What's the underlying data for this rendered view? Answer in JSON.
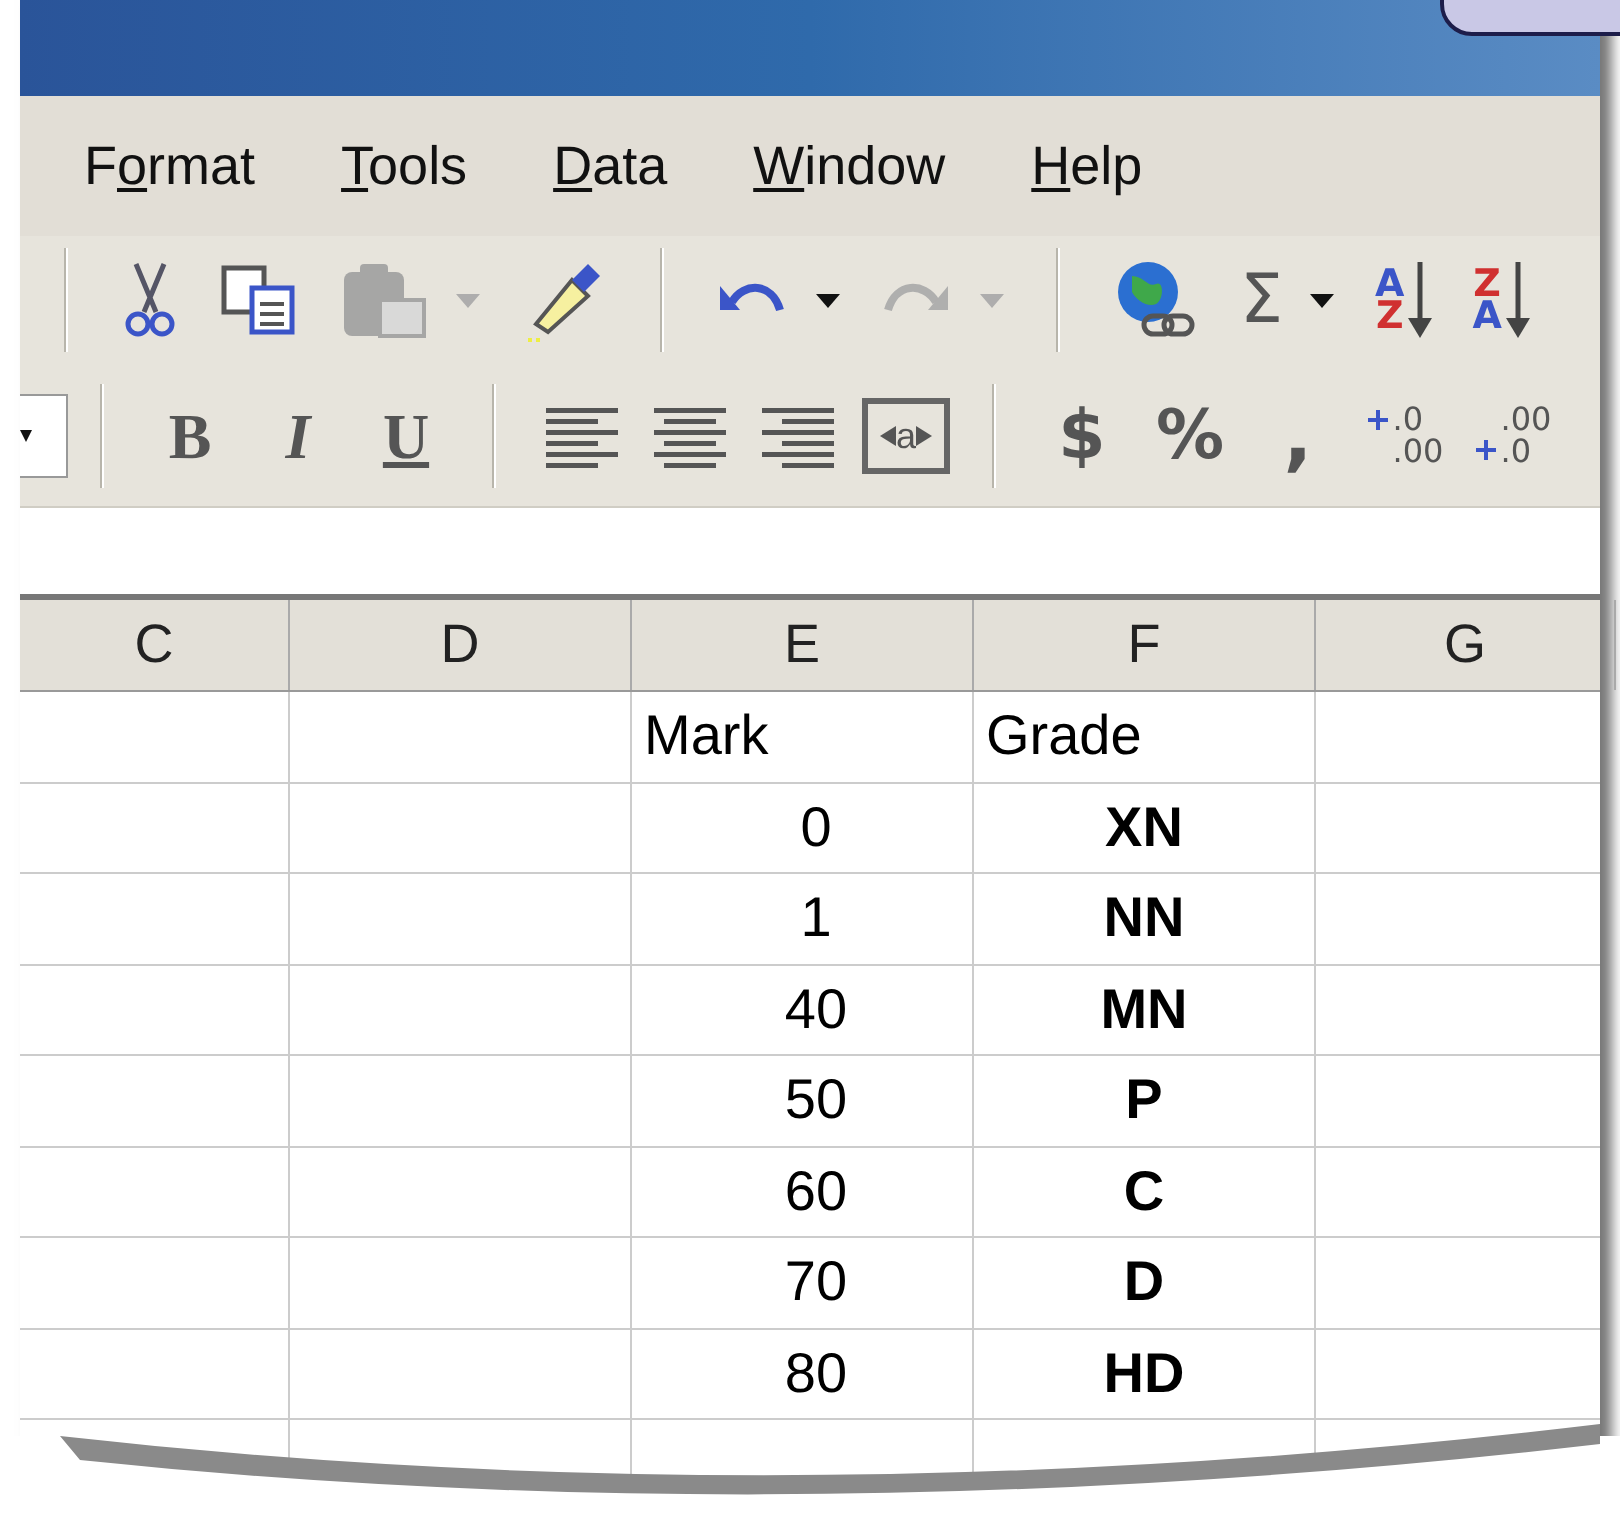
{
  "menu": [
    {
      "pre": "F",
      "accel": "o",
      "post": "rmat"
    },
    {
      "accel": "T",
      "post": "ools"
    },
    {
      "accel": "D",
      "post": "ata"
    },
    {
      "accel": "W",
      "post": "indow"
    },
    {
      "accel": "H",
      "post": "elp"
    }
  ],
  "standard_toolbar": [
    {
      "kind": "separator"
    },
    {
      "kind": "cut",
      "disabled": false
    },
    {
      "kind": "copy",
      "disabled": false
    },
    {
      "kind": "paste",
      "disabled": true,
      "dropdown": true
    },
    {
      "kind": "painter",
      "disabled": false
    },
    {
      "kind": "separator"
    },
    {
      "kind": "undo",
      "disabled": false,
      "dropdown": true
    },
    {
      "kind": "redo",
      "disabled": true,
      "dropdown": true
    },
    {
      "kind": "separator"
    },
    {
      "kind": "hyperlink",
      "disabled": false
    },
    {
      "kind": "sum",
      "glyph": "Σ",
      "disabled": false,
      "dropdown": true
    },
    {
      "kind": "sort",
      "glyph_top": "A",
      "glyph_bottom": "Z",
      "disabled": false
    },
    {
      "kind": "sort",
      "glyph_top": "Z",
      "glyph_bottom": "A",
      "disabled": false
    }
  ],
  "formatting_toolbar": [
    {
      "kind": "dropdown_edge"
    },
    {
      "kind": "separator"
    },
    {
      "kind": "bold",
      "glyph": "B"
    },
    {
      "kind": "italic",
      "glyph": "I"
    },
    {
      "kind": "underline",
      "glyph": "U"
    },
    {
      "kind": "separator"
    },
    {
      "kind": "align_left"
    },
    {
      "kind": "align_center"
    },
    {
      "kind": "align_right"
    },
    {
      "kind": "merge",
      "glyph": "a"
    },
    {
      "kind": "separator"
    },
    {
      "kind": "currency",
      "glyph": "$"
    },
    {
      "kind": "percent",
      "glyph": "%"
    },
    {
      "kind": "comma",
      "glyph": ","
    },
    {
      "kind": "decimal_increase",
      "glyph_top": ".0",
      "glyph_bottom": ".00"
    },
    {
      "kind": "decimal_decrease",
      "glyph_top": ".00",
      "glyph_bottom": ".0"
    }
  ],
  "sheet": {
    "columns": [
      "C",
      "D",
      "E",
      "F",
      "G"
    ],
    "rows": [
      {
        "kind": "header",
        "mark": "Mark",
        "grade": "Grade"
      },
      {
        "kind": "value",
        "mark": "0",
        "grade": "XN"
      },
      {
        "kind": "value",
        "mark": "1",
        "grade": "NN"
      },
      {
        "kind": "value",
        "mark": "40",
        "grade": "MN"
      },
      {
        "kind": "value",
        "mark": "50",
        "grade": "P"
      },
      {
        "kind": "value",
        "mark": "60",
        "grade": "C"
      },
      {
        "kind": "value",
        "mark": "70",
        "grade": "D"
      },
      {
        "kind": "value",
        "mark": "80",
        "grade": "HD"
      }
    ]
  }
}
